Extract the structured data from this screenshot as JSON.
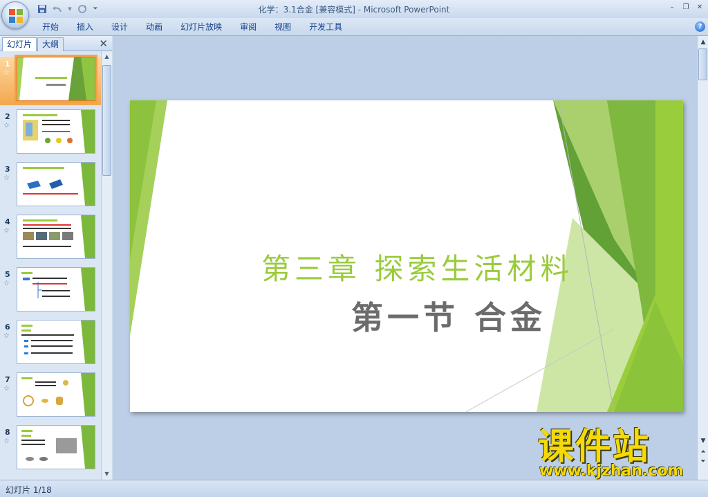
{
  "window": {
    "title": "化学：3.1合金 [兼容模式] - Microsoft PowerPoint"
  },
  "ribbon": {
    "tabs": [
      "开始",
      "插入",
      "设计",
      "动画",
      "幻灯片放映",
      "审阅",
      "视图",
      "开发工具"
    ]
  },
  "left_pane": {
    "tabs": {
      "slides": "幻灯片",
      "outline": "大纲"
    },
    "slides": [
      {
        "number": "1"
      },
      {
        "number": "2"
      },
      {
        "number": "3"
      },
      {
        "number": "4"
      },
      {
        "number": "5"
      },
      {
        "number": "6"
      },
      {
        "number": "7"
      },
      {
        "number": "8"
      }
    ],
    "selected_index": 0
  },
  "slide": {
    "title": "第三章 探索生活材料",
    "subtitle": "第一节 合金"
  },
  "status": {
    "slide_indicator": "幻灯片 1/18"
  },
  "watermark": {
    "brand": "课件站",
    "url": "www.kjzhan.com"
  },
  "colors": {
    "accent_green": "#9acb3c",
    "dark_green": "#5d9b2d",
    "selection_orange": "#f4a74d"
  }
}
